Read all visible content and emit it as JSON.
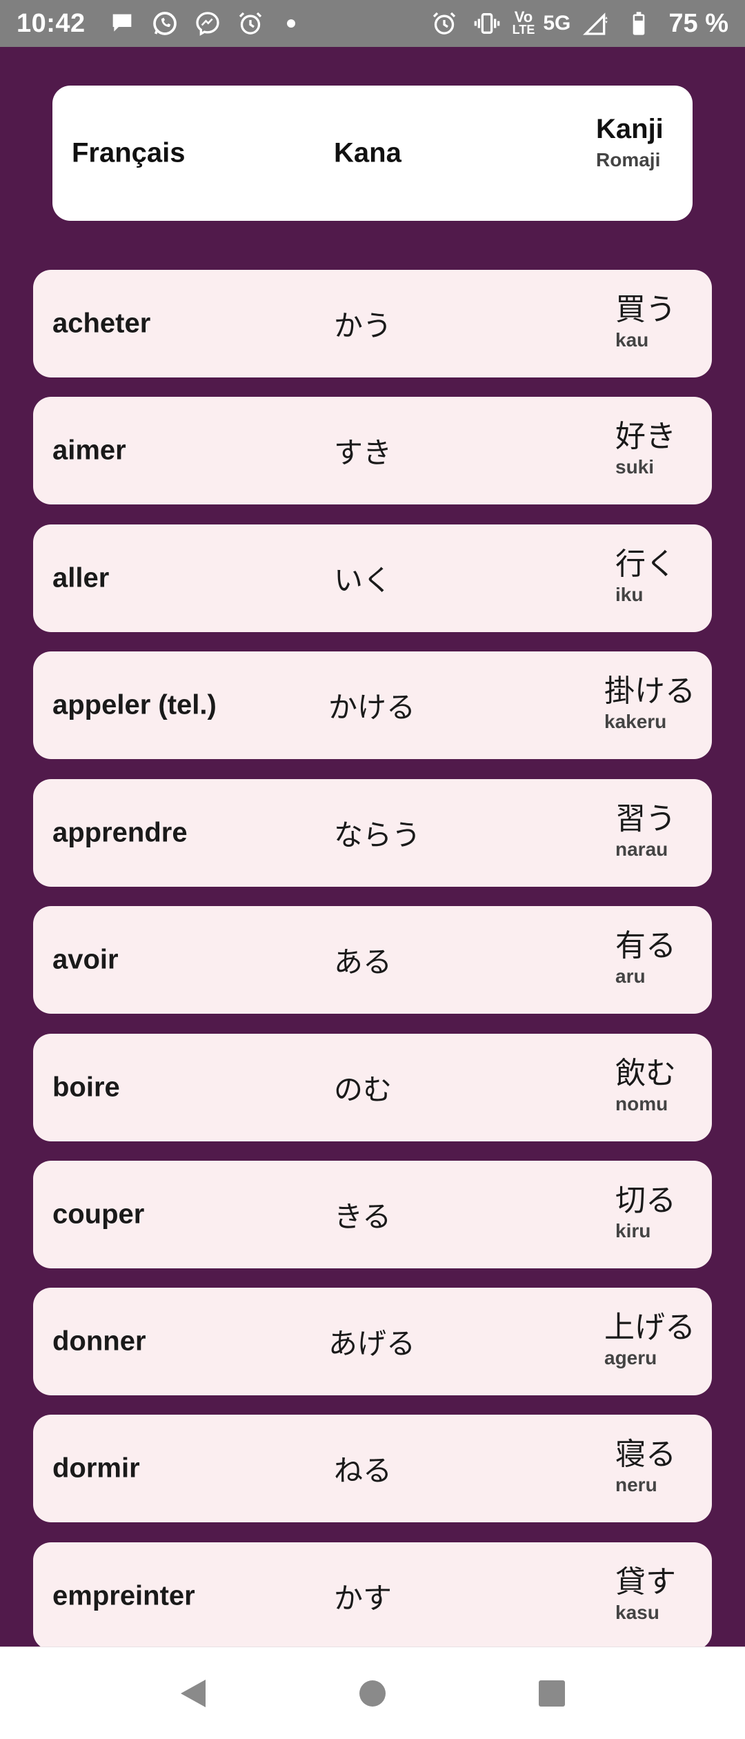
{
  "status_bar": {
    "time": "10:42",
    "left_icons": [
      "chat-bubble-icon",
      "whatsapp-icon",
      "messenger-icon",
      "alarm-icon"
    ],
    "right_icons": [
      "alarm-icon",
      "vibrate-icon",
      "volte-icon",
      "signal-icon",
      "battery-icon"
    ],
    "lte_label_top": "Vo",
    "lte_label_bottom": "LTE",
    "network": "5G",
    "battery": "75 %"
  },
  "header": {
    "col1": "Français",
    "col2": "Kana",
    "col3_top": "Kanji",
    "col3_bottom": "Romaji"
  },
  "rows": [
    {
      "fr": "acheter",
      "kana": "かう",
      "kanji": "買う",
      "romaji": "kau"
    },
    {
      "fr": "aimer",
      "kana": "すき",
      "kanji": "好き",
      "romaji": "suki"
    },
    {
      "fr": "aller",
      "kana": "いく",
      "kanji": "行く",
      "romaji": "iku"
    },
    {
      "fr": "appeler (tel.)",
      "kana": "かける",
      "kanji": "掛ける",
      "romaji": "kakeru"
    },
    {
      "fr": "apprendre",
      "kana": "ならう",
      "kanji": "習う",
      "romaji": "narau"
    },
    {
      "fr": "avoir",
      "kana": "ある",
      "kanji": "有る",
      "romaji": "aru"
    },
    {
      "fr": "boire",
      "kana": "のむ",
      "kanji": "飲む",
      "romaji": "nomu"
    },
    {
      "fr": "couper",
      "kana": "きる",
      "kanji": "切る",
      "romaji": "kiru"
    },
    {
      "fr": "donner",
      "kana": "あげる",
      "kanji": "上げる",
      "romaji": "ageru"
    },
    {
      "fr": "dormir",
      "kana": "ねる",
      "kanji": "寝る",
      "romaji": "neru"
    },
    {
      "fr": "empreinter",
      "kana": "かす",
      "kanji": "貸す",
      "romaji": "kasu"
    }
  ],
  "nav": [
    "back-icon",
    "home-icon",
    "recents-icon"
  ],
  "colors": {
    "status_bar": "#808080",
    "background": "#511a4b",
    "row_card": "#fbeef0",
    "header_card": "#ffffff"
  }
}
